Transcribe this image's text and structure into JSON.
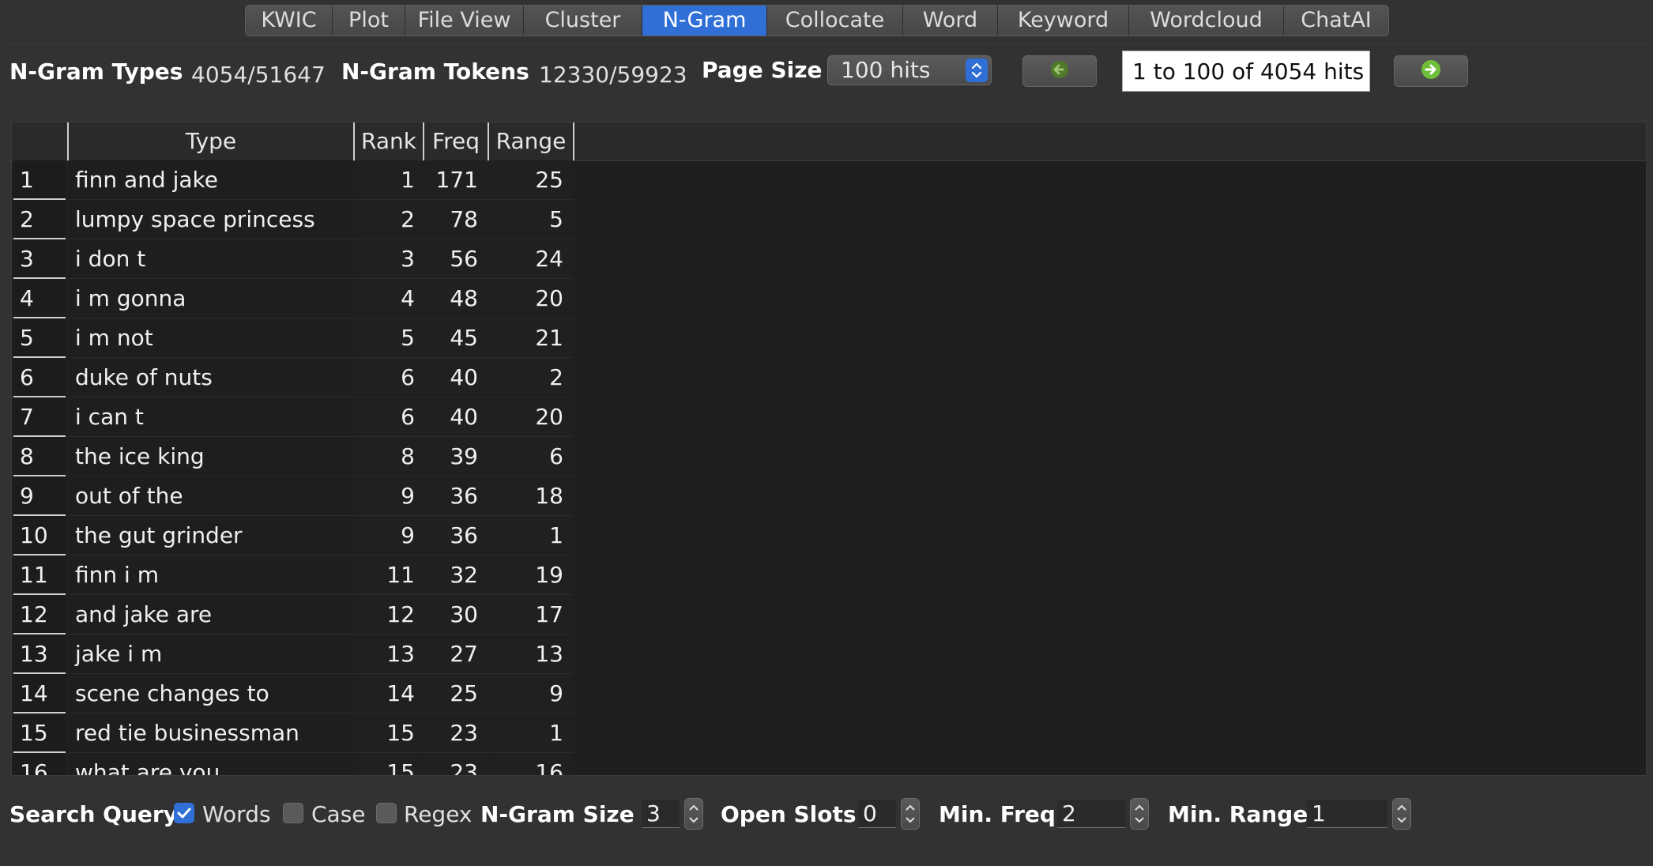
{
  "tabs": [
    {
      "label": "KWIC",
      "active": false
    },
    {
      "label": "Plot",
      "active": false
    },
    {
      "label": "File View",
      "active": false
    },
    {
      "label": "Cluster",
      "active": false
    },
    {
      "label": "N-Gram",
      "active": true
    },
    {
      "label": "Collocate",
      "active": false
    },
    {
      "label": "Word",
      "active": false
    },
    {
      "label": "Keyword",
      "active": false
    },
    {
      "label": "Wordcloud",
      "active": false
    },
    {
      "label": "ChatAI",
      "active": false
    }
  ],
  "stats": {
    "types_label": "N-Gram Types",
    "types_value": "4054/51647",
    "tokens_label": "N-Gram Tokens",
    "tokens_value": "12330/59923",
    "page_size_label": "Page Size",
    "page_size_value": "100 hits",
    "hits_display": "1 to 100 of 4054 hits"
  },
  "table": {
    "columns": [
      "Type",
      "Rank",
      "Freq",
      "Range"
    ],
    "rows": [
      {
        "n": "1",
        "type": "finn and jake",
        "rank": "1",
        "freq": "171",
        "range": "25"
      },
      {
        "n": "2",
        "type": "lumpy space princess",
        "rank": "2",
        "freq": "78",
        "range": "5"
      },
      {
        "n": "3",
        "type": "i don t",
        "rank": "3",
        "freq": "56",
        "range": "24"
      },
      {
        "n": "4",
        "type": "i m gonna",
        "rank": "4",
        "freq": "48",
        "range": "20"
      },
      {
        "n": "5",
        "type": "i m not",
        "rank": "5",
        "freq": "45",
        "range": "21"
      },
      {
        "n": "6",
        "type": "duke of nuts",
        "rank": "6",
        "freq": "40",
        "range": "2"
      },
      {
        "n": "7",
        "type": "i can t",
        "rank": "6",
        "freq": "40",
        "range": "20"
      },
      {
        "n": "8",
        "type": "the ice king",
        "rank": "8",
        "freq": "39",
        "range": "6"
      },
      {
        "n": "9",
        "type": "out of the",
        "rank": "9",
        "freq": "36",
        "range": "18"
      },
      {
        "n": "10",
        "type": "the gut grinder",
        "rank": "9",
        "freq": "36",
        "range": "1"
      },
      {
        "n": "11",
        "type": "finn i m",
        "rank": "11",
        "freq": "32",
        "range": "19"
      },
      {
        "n": "12",
        "type": "and jake are",
        "rank": "12",
        "freq": "30",
        "range": "17"
      },
      {
        "n": "13",
        "type": "jake i m",
        "rank": "13",
        "freq": "27",
        "range": "13"
      },
      {
        "n": "14",
        "type": "scene changes to",
        "rank": "14",
        "freq": "25",
        "range": "9"
      },
      {
        "n": "15",
        "type": "red tie businessman",
        "rank": "15",
        "freq": "23",
        "range": "1"
      },
      {
        "n": "16",
        "type": "what are you",
        "rank": "15",
        "freq": "23",
        "range": "16"
      }
    ]
  },
  "search": {
    "query_label": "Search Query",
    "words_label": "Words",
    "words_checked": true,
    "case_label": "Case",
    "case_checked": false,
    "regex_label": "Regex",
    "regex_checked": false,
    "ngram_size_label": "N-Gram Size",
    "ngram_size_value": "3",
    "open_slots_label": "Open Slots",
    "open_slots_value": "0",
    "min_freq_label": "Min. Freq",
    "min_freq_value": "2",
    "min_range_label": "Min. Range",
    "min_range_value": "1"
  },
  "icons": {
    "prev": "left-arrow-icon",
    "next": "right-arrow-icon",
    "select": "up-down-chevron-icon",
    "checkmark": "checkmark-icon"
  },
  "colors": {
    "accent": "#2f6fd6",
    "nav_arrow": "#6fbf3a"
  }
}
